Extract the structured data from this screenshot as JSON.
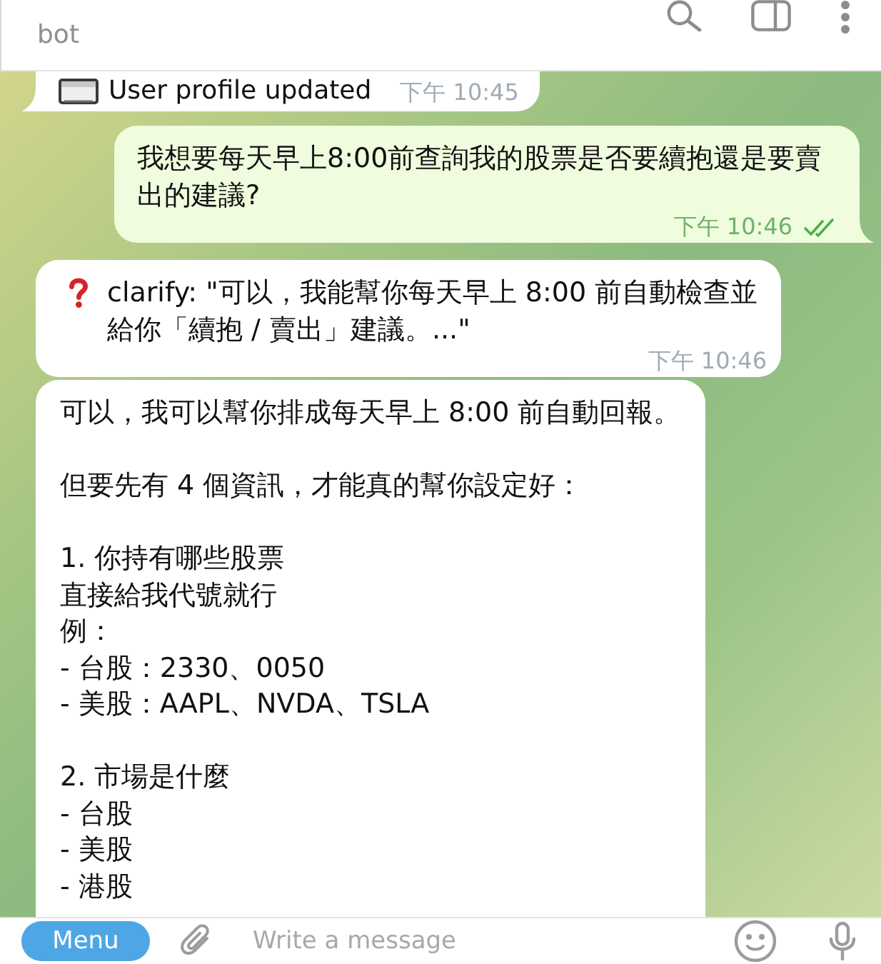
{
  "header": {
    "subtitle": "bot"
  },
  "messages": [
    {
      "kind": "status",
      "outgoing": false,
      "text": "User profile updated",
      "time": "下午 10:45"
    },
    {
      "kind": "plain",
      "outgoing": true,
      "text": "我想要每天早上8:00前查詢我的股票是否要續抱還是要賣出的建議?",
      "time": "下午 10:46",
      "read": true
    },
    {
      "kind": "question",
      "outgoing": false,
      "text": "clarify: \"可以，我能幫你每天早上 8:00 前自動檢查並給你「續抱 / 賣出」建議。...\"",
      "time": "下午 10:46"
    },
    {
      "kind": "long",
      "outgoing": false,
      "paragraphs": [
        [
          "可以，我可以幫你排成每天早上 8:00 前自動回報。"
        ],
        [
          "但要先有 4 個資訊，才能真的幫你設定好："
        ],
        [
          "1. 你持有哪些股票",
          "直接給我代號就行",
          "例：",
          "- 台股：2330、0050",
          "- 美股：AAPL、NVDA、TSLA"
        ],
        [
          "2. 市場是什麼",
          "- 台股",
          "- 美股",
          "- 港股"
        ]
      ]
    }
  ],
  "composer": {
    "menu_button": "Menu",
    "placeholder": "Write a message"
  }
}
